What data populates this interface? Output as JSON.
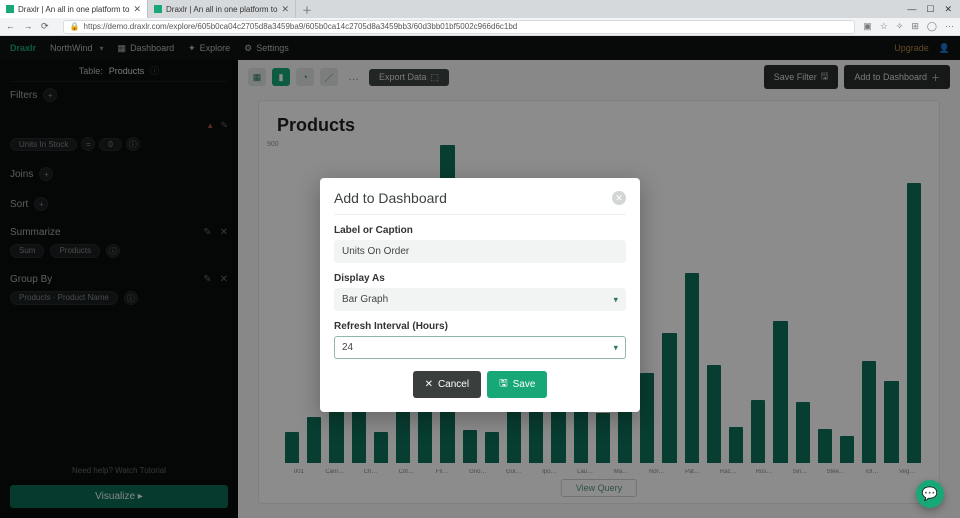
{
  "browser": {
    "tabs": [
      {
        "title": "Draxlr | An all in one platform to",
        "active": true
      },
      {
        "title": "Draxlr | An all in one platform to",
        "active": false
      }
    ],
    "url": "https://demo.draxlr.com/explore/605b0ca04c2705d8a3459ba9/605b0ca14c2705d8a3459bb3/60d3bb01bf5002c966d6c1bd",
    "win_min": "—",
    "win_max": "☐",
    "win_close": "✕"
  },
  "nav": {
    "brand": "Draxlr",
    "workspace": "NorthWind",
    "items": {
      "dashboard": "Dashboard",
      "explore": "Explore",
      "settings": "Settings"
    },
    "upgrade": "Upgrade"
  },
  "sidebar": {
    "table_label": "Table:",
    "table_value": "Products",
    "filters": "Filters",
    "joins": "Joins",
    "sort": "Sort",
    "summarize": "Summarize",
    "groupby": "Group By",
    "sum_pill": "Sum",
    "field_pill": "Products",
    "grouped_pill": "Products · Product Name",
    "help": "Need help? Watch Tutorial",
    "visualize": "Visualize"
  },
  "toolbar": {
    "export": "Export Data",
    "save_filter": "Save Filter",
    "add_dashboard": "Add to Dashboard"
  },
  "chart_data": {
    "type": "bar",
    "title": "Products",
    "ylabel": "900",
    "categories": [
      "001",
      "Cam…",
      "Ch…",
      "Côt…",
      "Fil…",
      "Gno…",
      "Gul…",
      "Ipo…",
      "Lau…",
      "Ma…",
      "Nor…",
      "Pât…",
      "Rac…",
      "Rös…",
      "Sin…",
      "Stee…",
      "Tof…",
      "Veg…"
    ],
    "values": [
      80,
      120,
      410,
      155,
      80,
      285,
      215,
      830,
      85,
      80,
      325,
      175,
      190,
      140,
      130,
      530,
      235,
      340,
      495,
      255,
      95,
      165,
      370,
      160,
      90,
      70,
      265,
      215,
      730
    ],
    "view_query": "View Query"
  },
  "modal": {
    "title": "Add to Dashboard",
    "label_field": "Label or Caption",
    "label_value": "Units On Order",
    "display_field": "Display As",
    "display_value": "Bar Graph",
    "refresh_field": "Refresh Interval (Hours)",
    "refresh_value": "24",
    "cancel": "Cancel",
    "save": "Save"
  }
}
